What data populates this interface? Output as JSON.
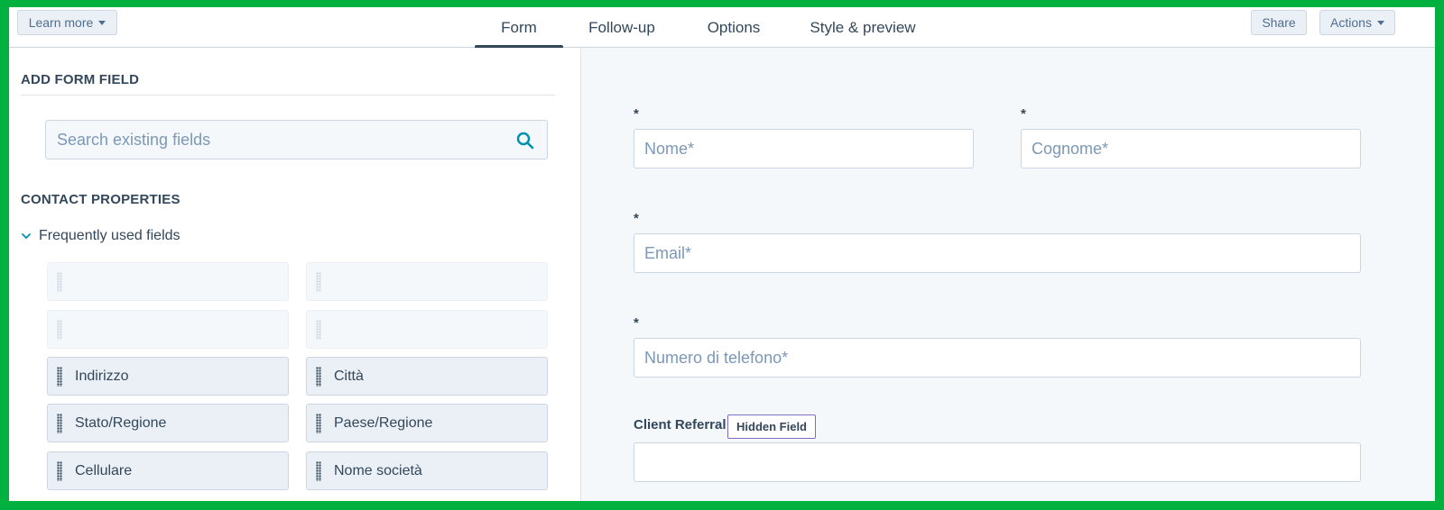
{
  "header": {
    "learn_more": "Learn more",
    "tabs": [
      {
        "label": "Form",
        "active": true
      },
      {
        "label": "Follow-up",
        "active": false
      },
      {
        "label": "Options",
        "active": false
      },
      {
        "label": "Style & preview",
        "active": false
      }
    ],
    "share": "Share",
    "actions": "Actions"
  },
  "sidebar": {
    "add_title": "ADD FORM FIELD",
    "search_placeholder": "Search existing fields",
    "properties_title": "CONTACT PROPERTIES",
    "group_label": "Frequently used fields",
    "fields": [
      "",
      "",
      "",
      "",
      "Indirizzo",
      "Città",
      "Stato/Regione",
      "Paese/Regione",
      "Cellulare",
      "Nome società"
    ]
  },
  "preview": {
    "required_mark": "*",
    "first_name_placeholder": "Nome*",
    "last_name_placeholder": "Cognome*",
    "email_placeholder": "Email*",
    "phone_placeholder": "Numero di telefono*",
    "referral_label": "Client Referral",
    "hidden_badge": "Hidden Field",
    "referral_value": ""
  },
  "colors": {
    "border_frame": "#00b140",
    "text_primary": "#33475b",
    "accent": "#0091ae"
  }
}
